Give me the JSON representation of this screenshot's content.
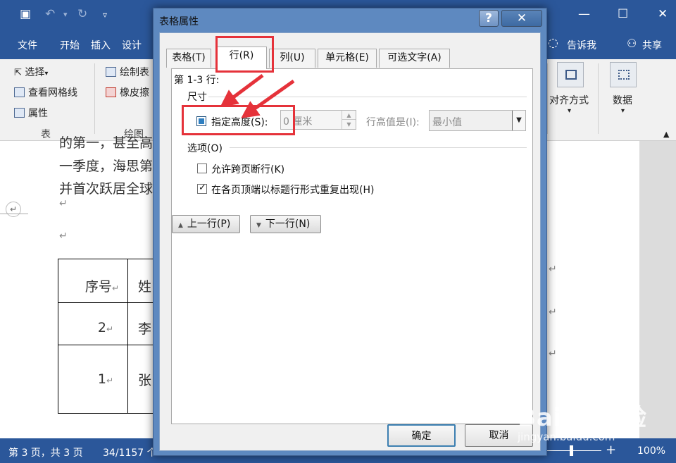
{
  "word": {
    "ribbon_tabs": [
      "文件",
      "开始",
      "插入",
      "设计"
    ],
    "tell_me": "告诉我",
    "share": "共享",
    "table_group": {
      "select": "选择",
      "gridlines": "查看网格线",
      "properties": "属性",
      "label": "表"
    },
    "draw_group": {
      "draw_table": "绘制表",
      "eraser": "橡皮擦",
      "label": "绘图"
    },
    "align_label": "对齐方式",
    "data_label": "数据",
    "document": {
      "line1": "的第一，甚至高",
      "line2": "一季度，海思第",
      "line3": "并首次跃居全球",
      "table": {
        "header_row": [
          "序号",
          "姓"
        ],
        "rows": [
          [
            "2",
            "李"
          ],
          [
            "1",
            "张"
          ]
        ]
      }
    },
    "status": {
      "page": "第 3 页，共 3 页",
      "words": "34/1157 个",
      "zoom": "100%"
    }
  },
  "dialog": {
    "title": "表格属性",
    "help": "?",
    "close": "✕",
    "tabs": [
      "表格(T)",
      "行(R)",
      "列(U)",
      "单元格(E)",
      "可选文字(A)"
    ],
    "active_tab": 1,
    "rows_label": "第 1-3 行:",
    "size_section": "尺寸",
    "specify_height": "指定高度(S):",
    "height_value": "0 厘米",
    "row_height_is": "行高值是(I):",
    "row_height_option": "最小值",
    "options_section": "选项(O)",
    "allow_break": "允许跨页断行(K)",
    "allow_break_checked": false,
    "repeat_header": "在各页顶端以标题行形式重复出现(H)",
    "repeat_header_checked": true,
    "prev_row": "上一行(P)",
    "next_row": "下一行(N)",
    "ok": "确定",
    "cancel": "取消"
  },
  "watermark": {
    "brand": "Baidu经验",
    "url": "jingyan.baidu.com"
  },
  "colors": {
    "word_blue": "#2b579a",
    "dialog_frame": "#5e89c0",
    "highlight_red": "#e5323a"
  }
}
